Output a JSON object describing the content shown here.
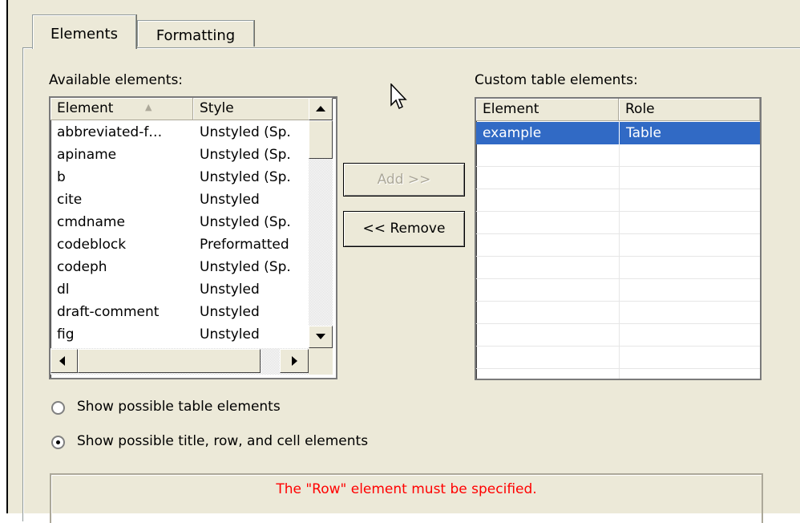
{
  "tabs": [
    {
      "label": "Elements",
      "active": true
    },
    {
      "label": "Formatting",
      "active": false
    }
  ],
  "available": {
    "label": "Available elements:",
    "columns": [
      "Element",
      "Style"
    ],
    "sort_indicator": "▲",
    "rows": [
      {
        "element": "abbreviated-f…",
        "style": "Unstyled (Sp."
      },
      {
        "element": "apiname",
        "style": "Unstyled (Sp."
      },
      {
        "element": "b",
        "style": "Unstyled (Sp."
      },
      {
        "element": "cite",
        "style": "Unstyled"
      },
      {
        "element": "cmdname",
        "style": "Unstyled (Sp."
      },
      {
        "element": "codeblock",
        "style": "Preformatted"
      },
      {
        "element": "codeph",
        "style": "Unstyled (Sp."
      },
      {
        "element": "dl",
        "style": "Unstyled"
      },
      {
        "element": "draft-comment",
        "style": "Unstyled"
      },
      {
        "element": "fig",
        "style": "Unstyled"
      }
    ]
  },
  "buttons": {
    "add": "Add >>",
    "remove": "<< Remove"
  },
  "custom": {
    "label": "Custom table elements:",
    "columns": [
      "Element",
      "Role"
    ],
    "rows": [
      {
        "element": "example",
        "role": "Table",
        "selected": true
      }
    ]
  },
  "options": [
    {
      "label": "Show possible table elements",
      "selected": false
    },
    {
      "label": "Show possible title, row, and cell elements",
      "selected": true
    }
  ],
  "status": {
    "message": "The \"Row\" element must be specified.",
    "color": "#ff0000"
  },
  "colors": {
    "selection": "#316ac5",
    "face": "#ece9d8"
  }
}
